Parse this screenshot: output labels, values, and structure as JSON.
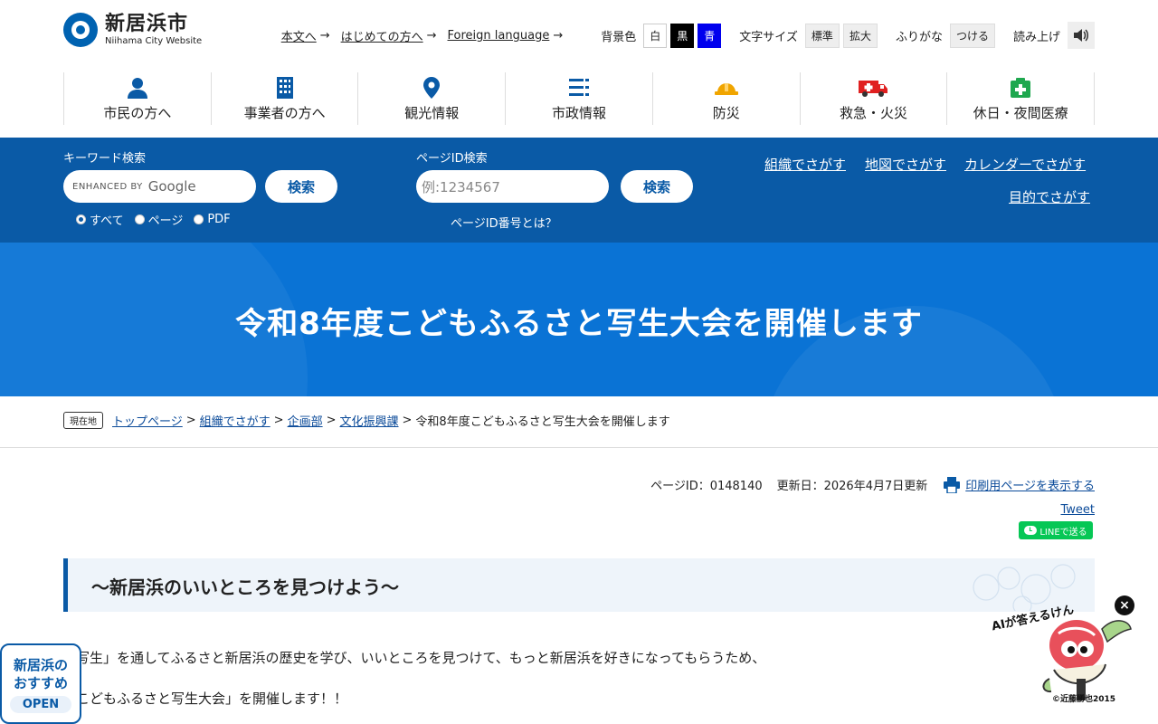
{
  "site": {
    "title": "新居浜市",
    "subtitle": "Niihama City Website"
  },
  "util": {
    "links": [
      "本文へ",
      "はじめての方へ",
      "Foreign language"
    ],
    "bg_label": "背景色",
    "bg_white": "白",
    "bg_black": "黒",
    "bg_blue": "青",
    "font_label": "文字サイズ",
    "font_standard": "標準",
    "font_large": "拡大",
    "furigana_label": "ふりがな",
    "furigana_on": "つける",
    "read_label": "読み上げ"
  },
  "gnav": [
    {
      "label": "市民の方へ",
      "icon": "person-icon"
    },
    {
      "label": "事業者の方へ",
      "icon": "building-icon"
    },
    {
      "label": "観光情報",
      "icon": "map-pin-icon"
    },
    {
      "label": "市政情報",
      "icon": "list-icon"
    },
    {
      "label": "防災",
      "icon": "helmet-icon"
    },
    {
      "label": "救急・火災",
      "icon": "ambulance-icon"
    },
    {
      "label": "休日・夜間医療",
      "icon": "first-aid-icon"
    }
  ],
  "search": {
    "keyword_label": "キーワード検索",
    "enhanced": "ENHANCED BY",
    "google": "Google",
    "button": "検索",
    "radios": [
      "すべて",
      "ページ",
      "PDF"
    ],
    "pageid_label": "ページID検索",
    "pageid_placeholder": "例:1234567",
    "pageid_help": "ページID番号とは？",
    "links": [
      "組織でさがす",
      "地図でさがす",
      "カレンダーでさがす",
      "目的でさがす"
    ]
  },
  "hero": {
    "title": "令和8年度こどもふるさと写生大会を開催します"
  },
  "breadcrumb": {
    "here": "現在地",
    "items": [
      "トップページ",
      "組織でさがす",
      "企画部",
      "文化振興課"
    ],
    "current": "令和8年度こどもふるさと写生大会を開催します"
  },
  "meta": {
    "page_id": "ページID：0148140",
    "updated": "更新日：2026年4月7日更新",
    "print": "印刷用ページを表示する",
    "tweet": "Tweet",
    "line": "LINEで送る"
  },
  "article": {
    "heading": "～新居浜のいいところを見つけよう～",
    "p1": "写生」を通してふるさと新居浜の歴史を学び、いいところを見つけて、もっと新居浜を好きになってもらうため、",
    "p2": "こどもふるさと写生大会」を開催します！！"
  },
  "float": {
    "recommend": "新居浜の",
    "recommend2": "おすすめ",
    "open": "OPEN",
    "ai_label": "AIが答えるけん",
    "copyright": "©近藤勝也2015"
  },
  "colors": {
    "primary": "#0a5aa6",
    "hero": "#0a73d5",
    "line": "#06c755"
  }
}
